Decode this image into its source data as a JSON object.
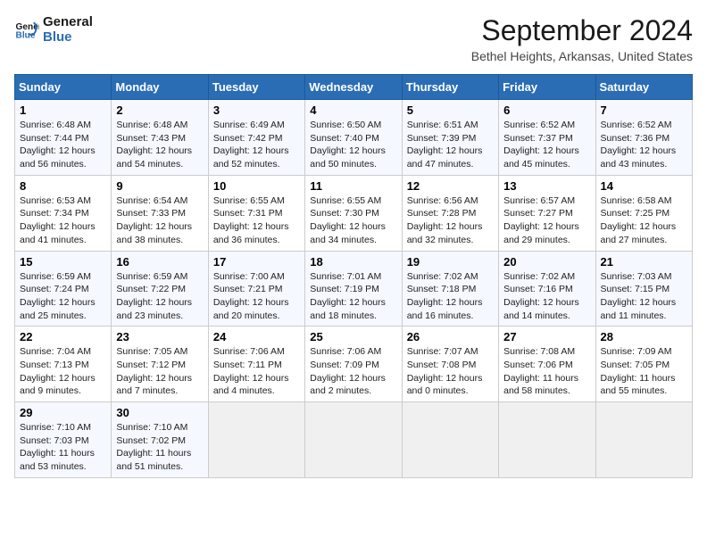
{
  "logo": {
    "line1": "General",
    "line2": "Blue"
  },
  "title": "September 2024",
  "location": "Bethel Heights, Arkansas, United States",
  "headers": [
    "Sunday",
    "Monday",
    "Tuesday",
    "Wednesday",
    "Thursday",
    "Friday",
    "Saturday"
  ],
  "weeks": [
    [
      {
        "day": "1",
        "sunrise": "6:48 AM",
        "sunset": "7:44 PM",
        "daylight": "12 hours and 56 minutes."
      },
      {
        "day": "2",
        "sunrise": "6:48 AM",
        "sunset": "7:43 PM",
        "daylight": "12 hours and 54 minutes."
      },
      {
        "day": "3",
        "sunrise": "6:49 AM",
        "sunset": "7:42 PM",
        "daylight": "12 hours and 52 minutes."
      },
      {
        "day": "4",
        "sunrise": "6:50 AM",
        "sunset": "7:40 PM",
        "daylight": "12 hours and 50 minutes."
      },
      {
        "day": "5",
        "sunrise": "6:51 AM",
        "sunset": "7:39 PM",
        "daylight": "12 hours and 47 minutes."
      },
      {
        "day": "6",
        "sunrise": "6:52 AM",
        "sunset": "7:37 PM",
        "daylight": "12 hours and 45 minutes."
      },
      {
        "day": "7",
        "sunrise": "6:52 AM",
        "sunset": "7:36 PM",
        "daylight": "12 hours and 43 minutes."
      }
    ],
    [
      {
        "day": "8",
        "sunrise": "6:53 AM",
        "sunset": "7:34 PM",
        "daylight": "12 hours and 41 minutes."
      },
      {
        "day": "9",
        "sunrise": "6:54 AM",
        "sunset": "7:33 PM",
        "daylight": "12 hours and 38 minutes."
      },
      {
        "day": "10",
        "sunrise": "6:55 AM",
        "sunset": "7:31 PM",
        "daylight": "12 hours and 36 minutes."
      },
      {
        "day": "11",
        "sunrise": "6:55 AM",
        "sunset": "7:30 PM",
        "daylight": "12 hours and 34 minutes."
      },
      {
        "day": "12",
        "sunrise": "6:56 AM",
        "sunset": "7:28 PM",
        "daylight": "12 hours and 32 minutes."
      },
      {
        "day": "13",
        "sunrise": "6:57 AM",
        "sunset": "7:27 PM",
        "daylight": "12 hours and 29 minutes."
      },
      {
        "day": "14",
        "sunrise": "6:58 AM",
        "sunset": "7:25 PM",
        "daylight": "12 hours and 27 minutes."
      }
    ],
    [
      {
        "day": "15",
        "sunrise": "6:59 AM",
        "sunset": "7:24 PM",
        "daylight": "12 hours and 25 minutes."
      },
      {
        "day": "16",
        "sunrise": "6:59 AM",
        "sunset": "7:22 PM",
        "daylight": "12 hours and 23 minutes."
      },
      {
        "day": "17",
        "sunrise": "7:00 AM",
        "sunset": "7:21 PM",
        "daylight": "12 hours and 20 minutes."
      },
      {
        "day": "18",
        "sunrise": "7:01 AM",
        "sunset": "7:19 PM",
        "daylight": "12 hours and 18 minutes."
      },
      {
        "day": "19",
        "sunrise": "7:02 AM",
        "sunset": "7:18 PM",
        "daylight": "12 hours and 16 minutes."
      },
      {
        "day": "20",
        "sunrise": "7:02 AM",
        "sunset": "7:16 PM",
        "daylight": "12 hours and 14 minutes."
      },
      {
        "day": "21",
        "sunrise": "7:03 AM",
        "sunset": "7:15 PM",
        "daylight": "12 hours and 11 minutes."
      }
    ],
    [
      {
        "day": "22",
        "sunrise": "7:04 AM",
        "sunset": "7:13 PM",
        "daylight": "12 hours and 9 minutes."
      },
      {
        "day": "23",
        "sunrise": "7:05 AM",
        "sunset": "7:12 PM",
        "daylight": "12 hours and 7 minutes."
      },
      {
        "day": "24",
        "sunrise": "7:06 AM",
        "sunset": "7:11 PM",
        "daylight": "12 hours and 4 minutes."
      },
      {
        "day": "25",
        "sunrise": "7:06 AM",
        "sunset": "7:09 PM",
        "daylight": "12 hours and 2 minutes."
      },
      {
        "day": "26",
        "sunrise": "7:07 AM",
        "sunset": "7:08 PM",
        "daylight": "12 hours and 0 minutes."
      },
      {
        "day": "27",
        "sunrise": "7:08 AM",
        "sunset": "7:06 PM",
        "daylight": "11 hours and 58 minutes."
      },
      {
        "day": "28",
        "sunrise": "7:09 AM",
        "sunset": "7:05 PM",
        "daylight": "11 hours and 55 minutes."
      }
    ],
    [
      {
        "day": "29",
        "sunrise": "7:10 AM",
        "sunset": "7:03 PM",
        "daylight": "11 hours and 53 minutes."
      },
      {
        "day": "30",
        "sunrise": "7:10 AM",
        "sunset": "7:02 PM",
        "daylight": "11 hours and 51 minutes."
      },
      null,
      null,
      null,
      null,
      null
    ]
  ]
}
